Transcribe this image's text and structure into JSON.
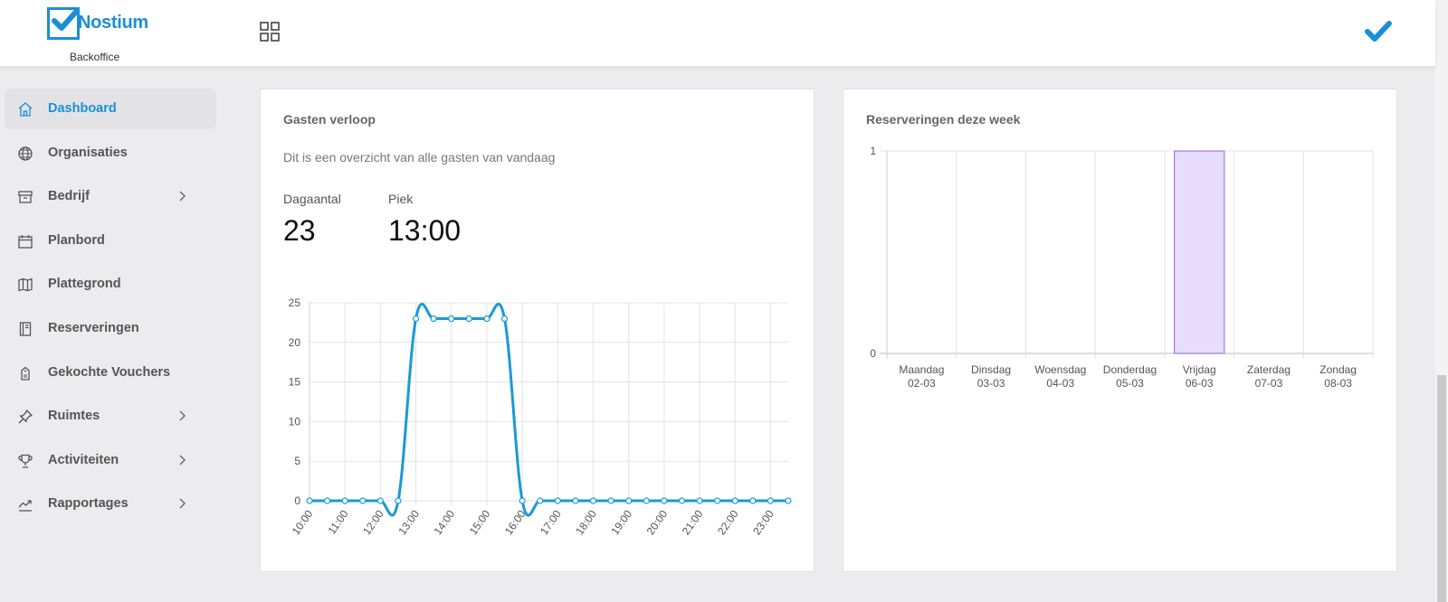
{
  "header": {
    "logo_text": "Nostium",
    "logo_sub": "Backoffice",
    "brand_color": "#1a8fd6"
  },
  "sidebar": {
    "items": [
      {
        "label": "Dashboard",
        "icon": "home-icon",
        "active": true,
        "has_children": false
      },
      {
        "label": "Organisaties",
        "icon": "globe-icon",
        "active": false,
        "has_children": false
      },
      {
        "label": "Bedrijf",
        "icon": "archive-icon",
        "active": false,
        "has_children": true
      },
      {
        "label": "Planbord",
        "icon": "calendar-icon",
        "active": false,
        "has_children": false
      },
      {
        "label": "Plattegrond",
        "icon": "map-icon",
        "active": false,
        "has_children": false
      },
      {
        "label": "Reserveringen",
        "icon": "book-icon",
        "active": false,
        "has_children": false
      },
      {
        "label": "Gekochte Vouchers",
        "icon": "voucher-icon",
        "active": false,
        "has_children": false
      },
      {
        "label": "Ruimtes",
        "icon": "pin-icon",
        "active": false,
        "has_children": true
      },
      {
        "label": "Activiteiten",
        "icon": "trophy-icon",
        "active": false,
        "has_children": true
      },
      {
        "label": "Rapportages",
        "icon": "chart-icon",
        "active": false,
        "has_children": true
      }
    ]
  },
  "guests_card": {
    "title": "Gasten verloop",
    "subtitle": "Dit is een overzicht van alle gasten van vandaag",
    "day_count_label": "Dagaantal",
    "day_count_value": "23",
    "peak_label": "Piek",
    "peak_value": "13:00"
  },
  "reservations_card": {
    "title": "Reserveringen deze week"
  },
  "chart_data": [
    {
      "type": "line",
      "title": "",
      "xlabel": "",
      "ylabel": "",
      "ylim": [
        0,
        25
      ],
      "yticks": [
        0,
        5,
        10,
        15,
        20,
        25
      ],
      "x": [
        "10:00",
        "10:30",
        "11:00",
        "11:30",
        "12:00",
        "12:30",
        "13:00",
        "13:30",
        "14:00",
        "14:30",
        "15:00",
        "15:30",
        "16:00",
        "16:30",
        "17:00",
        "17:30",
        "18:00",
        "18:30",
        "19:00",
        "19:30",
        "20:00",
        "20:30",
        "21:00",
        "21:30",
        "22:00",
        "22:30",
        "23:00",
        "23:30"
      ],
      "tick_labels": [
        "10:00",
        "11:00",
        "12:00",
        "13:00",
        "14:00",
        "15:00",
        "16:00",
        "17:00",
        "18:00",
        "19:00",
        "20:00",
        "21:00",
        "22:00",
        "23:00"
      ],
      "series": [
        {
          "values": [
            0,
            0,
            0,
            0,
            0,
            0,
            23,
            23,
            23,
            23,
            23,
            23,
            0,
            0,
            0,
            0,
            0,
            0,
            0,
            0,
            0,
            0,
            0,
            0,
            0,
            0,
            0,
            0
          ],
          "color": "#1a9ad6"
        }
      ],
      "grid": true
    },
    {
      "type": "bar",
      "title": "",
      "xlabel": "",
      "ylabel": "",
      "ylim": [
        0,
        1
      ],
      "yticks": [
        0,
        1
      ],
      "categories": [
        [
          "Maandag",
          "02-03"
        ],
        [
          "Dinsdag",
          "03-03"
        ],
        [
          "Woensdag",
          "04-03"
        ],
        [
          "Donderdag",
          "05-03"
        ],
        [
          "Vrijdag",
          "06-03"
        ],
        [
          "Zaterdag",
          "07-03"
        ],
        [
          "Zondag",
          "08-03"
        ]
      ],
      "values": [
        0,
        0,
        0,
        0,
        1,
        0,
        0
      ],
      "fill_color": "#e8ddfc",
      "stroke_color": "#9b7fd6",
      "grid": true
    }
  ]
}
